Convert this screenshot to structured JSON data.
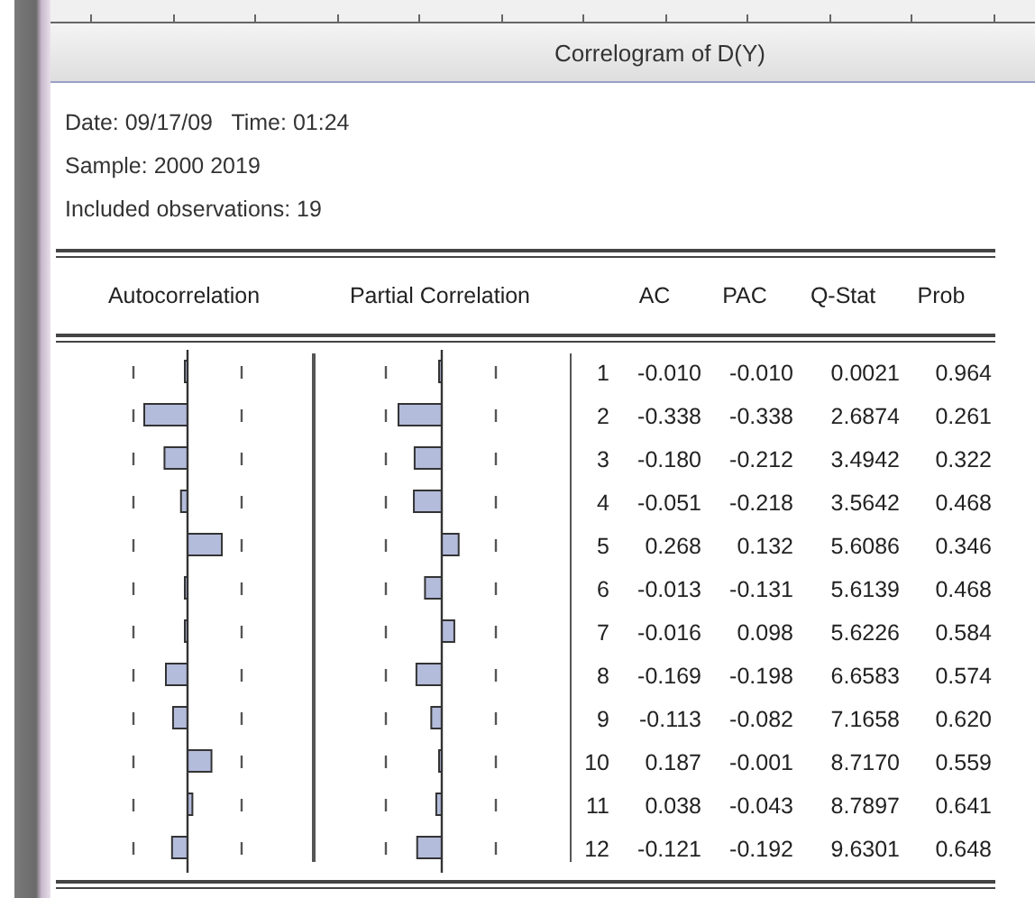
{
  "window": {
    "title": "Correlogram of D(Y)"
  },
  "header_lines": [
    "Date: 09/17/09   Time: 01:24",
    "Sample: 2000 2019",
    "Included observations: 19"
  ],
  "columns": [
    "Autocorrelation",
    "Partial Correlation",
    "AC",
    "PAC",
    "Q-Stat",
    "Prob"
  ],
  "rows": [
    {
      "lag": "1",
      "ac": "-0.010",
      "pac": "-0.010",
      "q_stat": "0.0021",
      "prob": "0.964"
    },
    {
      "lag": "2",
      "ac": "-0.338",
      "pac": "-0.338",
      "q_stat": "2.6874",
      "prob": "0.261"
    },
    {
      "lag": "3",
      "ac": "-0.180",
      "pac": "-0.212",
      "q_stat": "3.4942",
      "prob": "0.322"
    },
    {
      "lag": "4",
      "ac": "-0.051",
      "pac": "-0.218",
      "q_stat": "3.5642",
      "prob": "0.468"
    },
    {
      "lag": "5",
      "ac": "0.268",
      "pac": "0.132",
      "q_stat": "5.6086",
      "prob": "0.346"
    },
    {
      "lag": "6",
      "ac": "-0.013",
      "pac": "-0.131",
      "q_stat": "5.6139",
      "prob": "0.468"
    },
    {
      "lag": "7",
      "ac": "-0.016",
      "pac": "0.098",
      "q_stat": "5.6226",
      "prob": "0.584"
    },
    {
      "lag": "8",
      "ac": "-0.169",
      "pac": "-0.198",
      "q_stat": "6.6583",
      "prob": "0.574"
    },
    {
      "lag": "9",
      "ac": "-0.113",
      "pac": "-0.082",
      "q_stat": "7.1658",
      "prob": "0.620"
    },
    {
      "lag": "10",
      "ac": "0.187",
      "pac": "-0.001",
      "q_stat": "8.7170",
      "prob": "0.559"
    },
    {
      "lag": "11",
      "ac": "0.038",
      "pac": "-0.043",
      "q_stat": "8.7897",
      "prob": "0.641"
    },
    {
      "lag": "12",
      "ac": "-0.121",
      "pac": "-0.192",
      "q_stat": "9.6301",
      "prob": "0.648"
    }
  ]
}
